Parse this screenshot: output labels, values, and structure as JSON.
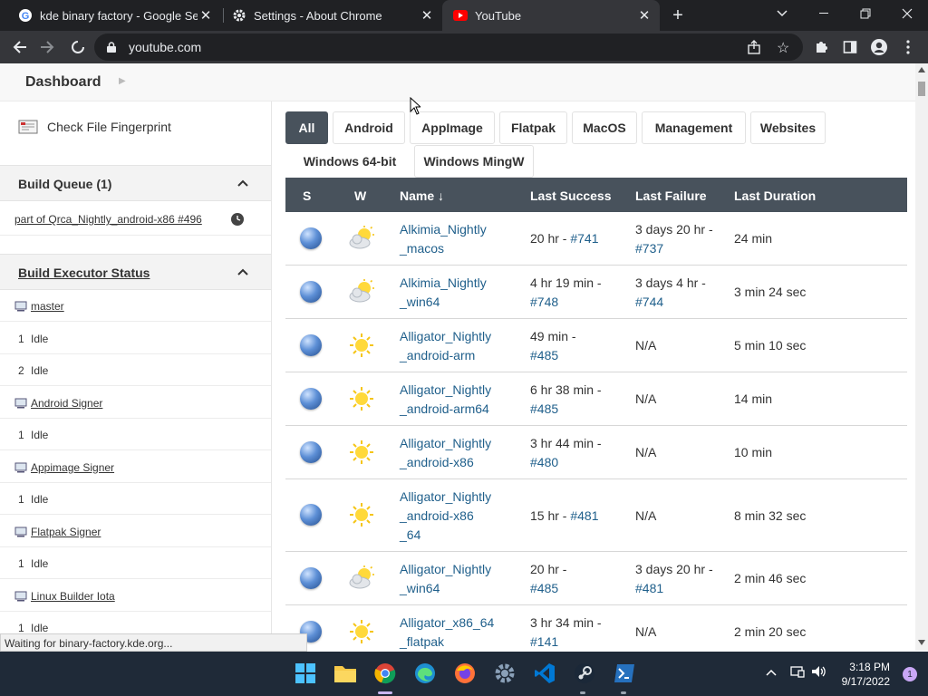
{
  "browser": {
    "tabs": [
      {
        "title": "kde binary factory - Google Sear",
        "icon": "google-icon",
        "active": false
      },
      {
        "title": "Settings - About Chrome",
        "icon": "gear-icon",
        "active": false
      },
      {
        "title": "YouTube",
        "icon": "youtube-icon",
        "active": true
      }
    ],
    "url": "youtube.com"
  },
  "breadcrumb": {
    "root": "Dashboard"
  },
  "sidebar": {
    "fingerprint_label": "Check File Fingerprint",
    "queue": {
      "title": "Build Queue (1)",
      "item": "part of Qrca_Nightly_android-x86 #496"
    },
    "executors": {
      "title": "Build Executor Status",
      "rows": [
        {
          "type": "node",
          "label": "master"
        },
        {
          "type": "exec",
          "num": "1",
          "status": "Idle"
        },
        {
          "type": "exec",
          "num": "2",
          "status": "Idle"
        },
        {
          "type": "node",
          "label": "Android Signer"
        },
        {
          "type": "exec",
          "num": "1",
          "status": "Idle"
        },
        {
          "type": "node",
          "label": "Appimage Signer"
        },
        {
          "type": "exec",
          "num": "1",
          "status": "Idle"
        },
        {
          "type": "node",
          "label": "Flatpak Signer"
        },
        {
          "type": "exec",
          "num": "1",
          "status": "Idle"
        },
        {
          "type": "node",
          "label": "Linux Builder Iota"
        },
        {
          "type": "exec",
          "num": "1",
          "status": "Idle"
        }
      ]
    }
  },
  "views": {
    "tabs": [
      "All",
      "Android",
      "AppImage",
      "Flatpak",
      "MacOS",
      "Management",
      "Websites",
      "Windows 64-bit",
      "Windows MingW"
    ],
    "active": "All"
  },
  "jobs": {
    "headers": {
      "s": "S",
      "w": "W",
      "name": "Name ↓",
      "last_success": "Last Success",
      "last_failure": "Last Failure",
      "last_duration": "Last Duration"
    },
    "rows": [
      {
        "name": [
          "Alkimia_Nightly",
          "_macos"
        ],
        "success": [
          "20 hr - ",
          "#741"
        ],
        "success_oneline": true,
        "failure": [
          "3 days 20 hr -",
          "#737"
        ],
        "duration": "24 min",
        "weather": "cloudy"
      },
      {
        "name": [
          "Alkimia_Nightly",
          "_win64"
        ],
        "success": [
          "4 hr 19 min -",
          "#748"
        ],
        "success_oneline": false,
        "failure": [
          "3 days 4 hr -",
          "#744"
        ],
        "duration": "3 min 24 sec",
        "weather": "cloudy"
      },
      {
        "name": [
          "Alligator_Nightly",
          "_android-arm"
        ],
        "success": [
          "49 min -",
          "#485"
        ],
        "success_oneline": false,
        "failure": [
          "N/A"
        ],
        "duration": "5 min 10 sec",
        "weather": "sunny"
      },
      {
        "name": [
          "Alligator_Nightly",
          "_android-arm64"
        ],
        "success": [
          "6 hr 38 min -",
          "#485"
        ],
        "success_oneline": false,
        "failure": [
          "N/A"
        ],
        "duration": "14 min",
        "weather": "sunny"
      },
      {
        "name": [
          "Alligator_Nightly",
          "_android-x86"
        ],
        "success": [
          "3 hr 44 min -",
          "#480"
        ],
        "success_oneline": false,
        "failure": [
          "N/A"
        ],
        "duration": "10 min",
        "weather": "sunny"
      },
      {
        "name": [
          "Alligator_Nightly",
          "_android-x86",
          "_64"
        ],
        "success": [
          "15 hr - ",
          "#481"
        ],
        "success_oneline": true,
        "failure": [
          "N/A"
        ],
        "duration": "8 min 32 sec",
        "weather": "sunny"
      },
      {
        "name": [
          "Alligator_Nightly",
          "_win64"
        ],
        "success": [
          "20 hr -",
          "#485"
        ],
        "success_oneline": false,
        "failure": [
          "3 days 20 hr -",
          "#481"
        ],
        "duration": "2 min 46 sec",
        "weather": "cloudy"
      },
      {
        "name": [
          "Alligator_x86_64",
          "_flatpak"
        ],
        "success": [
          "3 hr 34 min -",
          "#141"
        ],
        "success_oneline": false,
        "failure": [
          "N/A"
        ],
        "duration": "2 min 20 sec",
        "weather": "sunny"
      }
    ]
  },
  "status_bar": "Waiting for binary-factory.kde.org...",
  "taskbar": {
    "apps": [
      "windows-start-icon",
      "file-explorer-icon",
      "chrome-icon",
      "edge-icon",
      "firefox-icon",
      "settings-icon",
      "vscode-icon",
      "steam-icon",
      "powershell-icon"
    ],
    "time": "3:18 PM",
    "date": "9/17/2022",
    "notifications": "1"
  },
  "colors": {
    "accent_header": "#48525c",
    "link": "#1f5f8b",
    "taskbar": "#1f2a38"
  }
}
